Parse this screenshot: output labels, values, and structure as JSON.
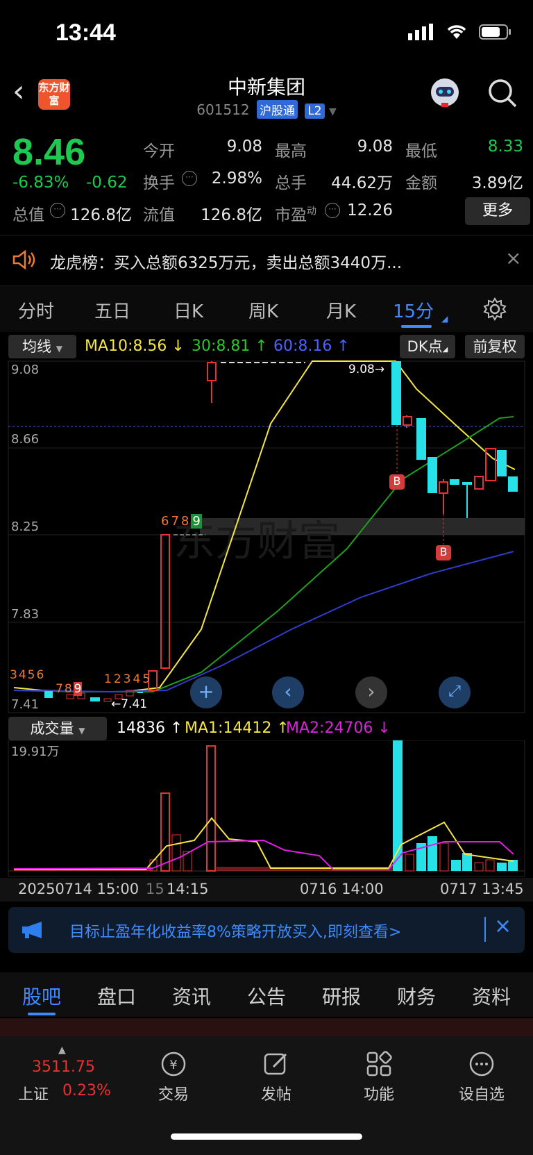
{
  "status_bar": {
    "time": "13:44"
  },
  "header": {
    "logo_text": "东方财富",
    "stock_name": "中新集团",
    "stock_code": "601512",
    "tag_connect": "沪股通",
    "tag_level": "L2"
  },
  "quote": {
    "price": "8.46",
    "change_pct": "-6.83%",
    "change_amt": "-0.62",
    "fields": {
      "open_label": "今开",
      "open": "9.08",
      "high_label": "最高",
      "high": "9.08",
      "low_label": "最低",
      "low": "8.33",
      "turnover_label": "换手",
      "turnover": "2.98%",
      "total_hands_label": "总手",
      "total_hands": "44.62万",
      "amount_label": "金额",
      "amount": "3.89亿",
      "mktcap_label": "总值",
      "mktcap": "126.8亿",
      "float_label": "流值",
      "float": "126.8亿",
      "pe_label": "市盈",
      "pe_sup": "动",
      "pe": "12.26"
    },
    "more_button": "更多"
  },
  "notice": {
    "text": "龙虎榜：买入总额6325万元，卖出总额3440万..."
  },
  "chart_tabs": [
    "分时",
    "五日",
    "日K",
    "周K",
    "月K",
    "15分"
  ],
  "active_tab": "15分",
  "indicator": {
    "selector": "均线",
    "ma10": "MA10:8.56 ↓",
    "ma30": "30:8.81 ↑",
    "ma60": "60:8.16 ↑",
    "dk_button": "DK点",
    "adjust_button": "前复权"
  },
  "price_axis": [
    "9.08",
    "8.66",
    "8.25",
    "7.83",
    "7.41"
  ],
  "annotations": {
    "high_marker": "9.08→",
    "low_marker": "←7.41",
    "buy_signal": "B",
    "seq_top": [
      "6",
      "7",
      "8",
      "9"
    ],
    "seq_left_a": [
      "3",
      "4",
      "5",
      "6"
    ],
    "seq_left_b": [
      "7",
      "8",
      "9"
    ],
    "seq_left_c": [
      "1",
      "2",
      "3",
      "4",
      "5"
    ]
  },
  "chart_colors": {
    "up": "#e63232",
    "down": "#27e0e8",
    "ma10": "#f5e642",
    "ma30": "#1fa01f",
    "ma60": "#2f3dcc",
    "ma1": "#f5e642",
    "ma2": "#e020e0"
  },
  "volume": {
    "selector": "成交量",
    "value": "14836 ↑",
    "ma1": "MA1:14412 ↑",
    "ma2": "MA2:24706 ↓",
    "axis_max": "19.91万"
  },
  "x_axis": {
    "left": "20250714 15:00",
    "cut": "15",
    "t1": "14:15",
    "t2": "0716 14:00",
    "t3": "0717 13:45"
  },
  "banner": {
    "text": "目标止盈年化收益率8%策略开放买入,即刻查看>"
  },
  "bottom_tabs": [
    "股吧",
    "盘口",
    "资讯",
    "公告",
    "研报",
    "财务",
    "资料"
  ],
  "active_bottom_tab": "股吧",
  "footer": {
    "index_value": "3511.75",
    "index_name": "上证",
    "index_change": "0.23%",
    "items": [
      "交易",
      "发帖",
      "功能",
      "设自选"
    ]
  }
}
